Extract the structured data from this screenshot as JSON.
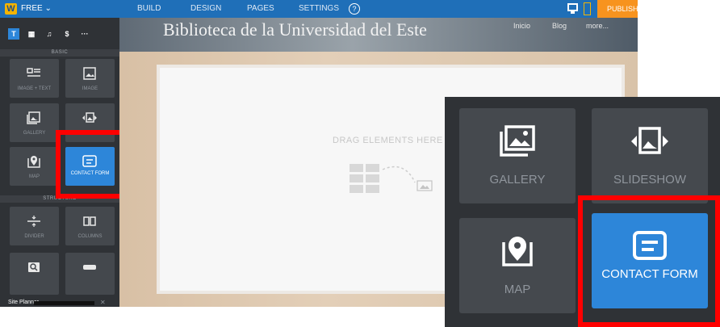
{
  "topbar": {
    "logo": "W",
    "plan": "FREE ⌄",
    "nav": [
      "BUILD",
      "DESIGN",
      "PAGES",
      "SETTINGS"
    ],
    "help": "?",
    "publish": "PUBLISH"
  },
  "sidebar": {
    "tools": [
      "T",
      "▦",
      "♫",
      "$",
      "···"
    ],
    "sections": {
      "basic": "BASIC",
      "structure": "STRUCTURE"
    },
    "tiles": {
      "image_text": "IMAGE + TEXT",
      "image": "IMAGE",
      "gallery": "GALLERY",
      "slideshow": "",
      "map": "MAP",
      "contact_form": "CONTACT FORM",
      "divider": "DIVIDER",
      "columns": "COLUMNS"
    },
    "site_planner": "Site Planner",
    "close": "✕"
  },
  "site": {
    "title": "Biblioteca de la Universidad del Este",
    "nav": [
      "Inicio",
      "Blog",
      "more..."
    ]
  },
  "canvas": {
    "drag_text": "DRAG ELEMENTS HERE"
  },
  "zoom": {
    "gallery": "GALLERY",
    "slideshow": "SLIDESHOW",
    "map": "MAP",
    "contact_form": "CONTACT FORM"
  },
  "colors": {
    "highlight": "#ff0000",
    "active_tile": "#2d86d9",
    "publish": "#f7931e",
    "topbar": "#1f6fb8"
  }
}
